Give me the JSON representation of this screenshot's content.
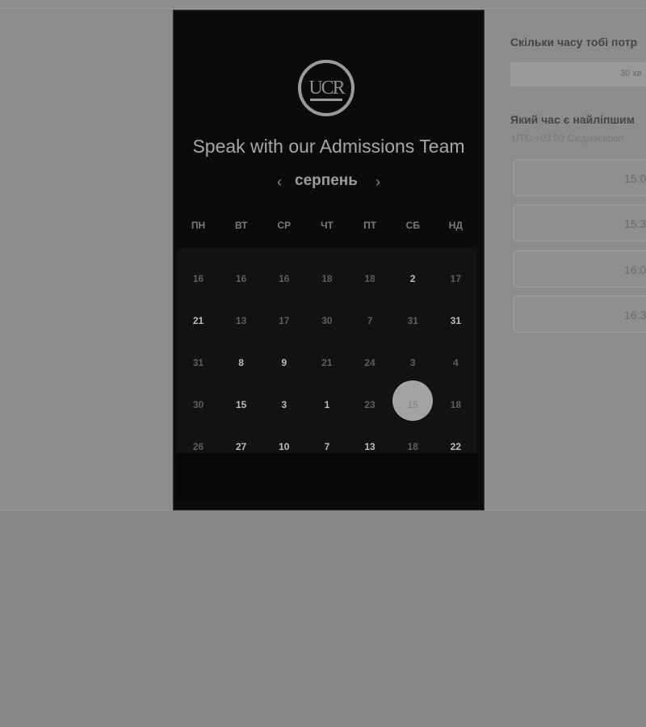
{
  "right_panel": {
    "question_duration": "Скільки часу тобі потр",
    "duration_value": "30 хв",
    "question_time": "Який час є найліпшим",
    "timezone": "UTC +03:00 Східноєвроп",
    "time_slots": [
      "15:0",
      "15:3",
      "16:0",
      "16:3"
    ]
  },
  "modal": {
    "logo_text": "UCR",
    "title": "Speak with our Admissions Team",
    "month": "серпень",
    "prev_icon": "‹",
    "next_icon": "›",
    "weekdays": [
      "ПН",
      "ВТ",
      "СР",
      "ЧТ",
      "ПТ",
      "СБ",
      "НД"
    ],
    "weeks": [
      [
        "16",
        "16",
        "16",
        "18",
        "18",
        "2",
        "17"
      ],
      [
        "21",
        "13",
        "17",
        "30",
        "7",
        "31",
        "31"
      ],
      [
        "31",
        "8",
        "9",
        "21",
        "24",
        "3",
        "4"
      ],
      [
        "30",
        "15",
        "3",
        "1",
        "23",
        "15",
        "18"
      ],
      [
        "26",
        "27",
        "10",
        "7",
        "13",
        "18",
        "22"
      ]
    ],
    "selected": {
      "week": 3,
      "day": 5
    },
    "bright_cells": [
      [
        0,
        5
      ],
      [
        1,
        0
      ],
      [
        1,
        6
      ],
      [
        2,
        1
      ],
      [
        2,
        2
      ],
      [
        3,
        1
      ],
      [
        3,
        2
      ],
      [
        3,
        3
      ],
      [
        4,
        1
      ],
      [
        4,
        2
      ],
      [
        4,
        3
      ],
      [
        4,
        4
      ],
      [
        4,
        6
      ]
    ]
  },
  "icons": [
    "ucr-logo-icon",
    "chevron-left-icon",
    "chevron-right-icon"
  ]
}
